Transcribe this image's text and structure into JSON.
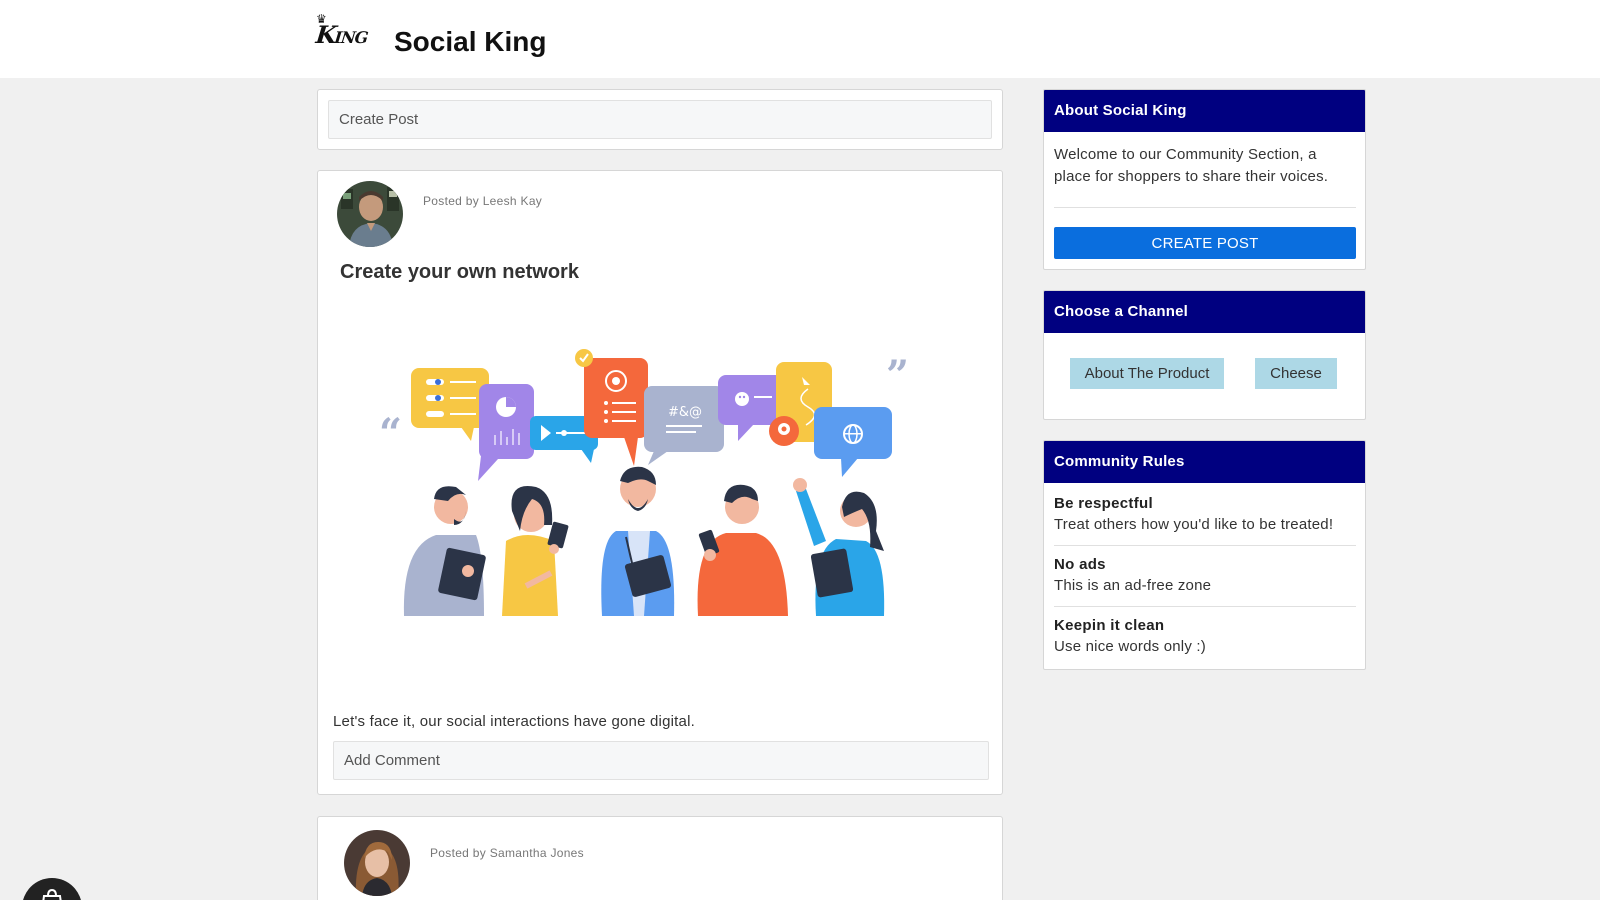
{
  "header": {
    "logo_text": "KING",
    "site_title": "Social King"
  },
  "create_post": {
    "placeholder": "Create Post"
  },
  "posts": [
    {
      "posted_by": "Posted by Leesh Kay",
      "title": "Create your own network",
      "body": "Let's face it, our social interactions have gone digital.",
      "comment_placeholder": "Add Comment",
      "illustration_text": "#&@"
    },
    {
      "posted_by": "Posted by Samantha Jones"
    }
  ],
  "sidebar": {
    "about": {
      "heading": "About Social King",
      "text": "Welcome to our Community Section, a place for shoppers to share their voices.",
      "button": "CREATE POST"
    },
    "channels": {
      "heading": "Choose a Channel",
      "items": [
        {
          "label": "About The Product"
        },
        {
          "label": "Cheese"
        }
      ]
    },
    "rules": {
      "heading": "Community Rules",
      "items": [
        {
          "title": "Be respectful",
          "desc": "Treat others how you'd like to be treated!"
        },
        {
          "title": "No ads",
          "desc": "This is an ad-free zone"
        },
        {
          "title": "Keepin it clean",
          "desc": "Use nice words only :)"
        }
      ]
    }
  },
  "colors": {
    "header_band": "#000080",
    "primary_button": "#0a6ede",
    "chip": "#add8e6",
    "page_bg": "#f0f0f0"
  },
  "icons": {
    "fab": "shopping-bag-icon"
  }
}
